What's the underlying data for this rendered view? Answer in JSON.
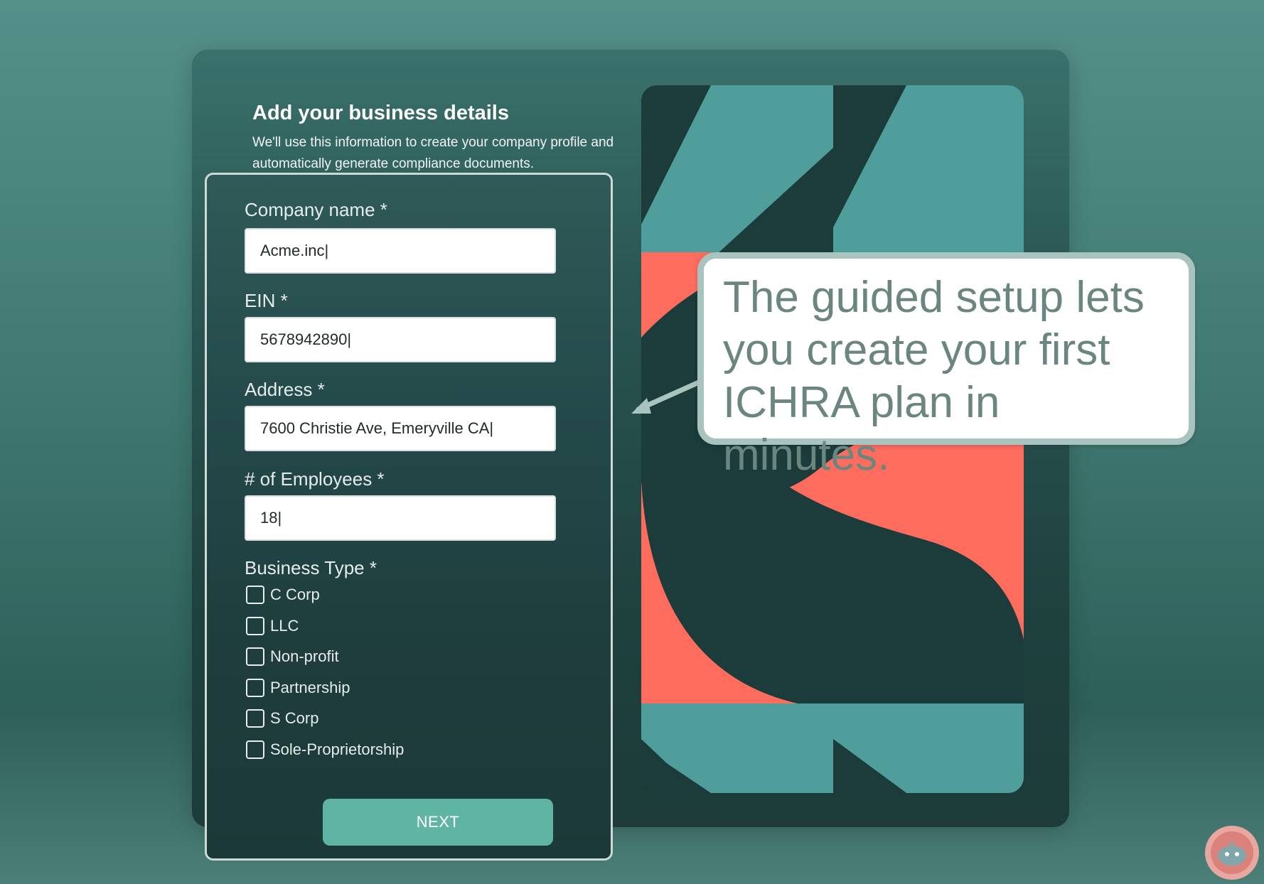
{
  "form": {
    "heading": "Add your business details",
    "subtext": "We'll use this information to create your company profile and automatically generate compliance documents.",
    "fields": [
      {
        "label": "Company name *",
        "value": "Acme.inc|"
      },
      {
        "label": "EIN *",
        "value": "5678942890|"
      },
      {
        "label": "Address *",
        "value": "7600 Christie Ave, Emeryville CA|"
      },
      {
        "label": "# of Employees *",
        "value": "18|"
      }
    ],
    "business_type": {
      "label": "Business Type *",
      "options": [
        {
          "label": "C Corp",
          "checked": false
        },
        {
          "label": "LLC",
          "checked": false
        },
        {
          "label": "Non-profit",
          "checked": false
        },
        {
          "label": "Partnership",
          "checked": false
        },
        {
          "label": "S Corp",
          "checked": false
        },
        {
          "label": "Sole-Proprietorship",
          "checked": false
        }
      ]
    },
    "next_label": "NEXT"
  },
  "callout": {
    "text": "The guided setup lets you create your first ICHRA plan in minutes."
  },
  "icons": {
    "assistant": "chatbot-icon",
    "pointer": "arrow-icon"
  },
  "colors": {
    "button": "#5fb4a3",
    "art_teal": "#4f9e9c",
    "art_dark": "#1b3c3b",
    "art_coral": "#fe6c5e",
    "callout_border": "#a9c4bf",
    "callout_text": "#6b8580"
  }
}
